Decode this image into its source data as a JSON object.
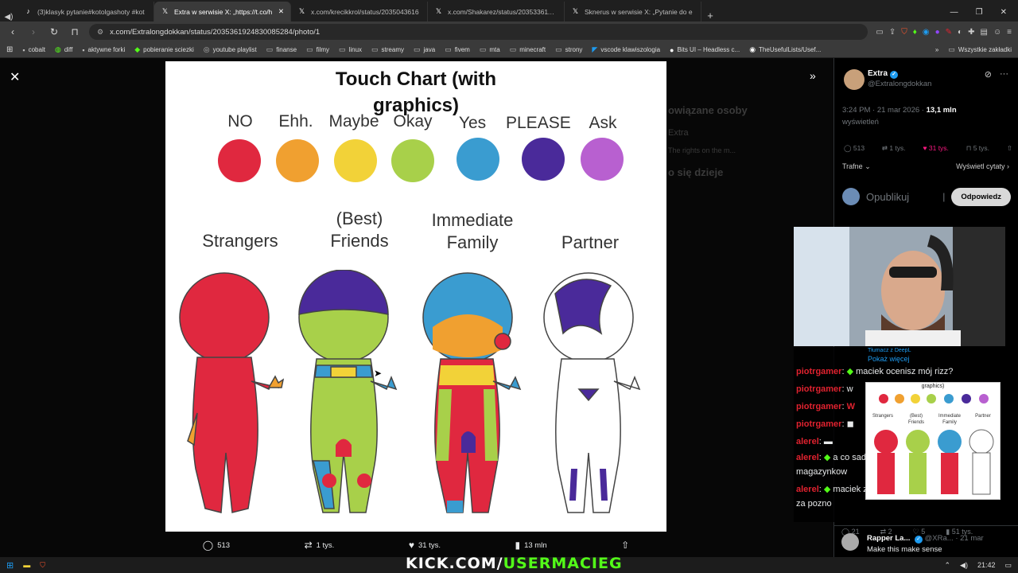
{
  "tabs": [
    {
      "label": "(3)klasyk pytanie#kotolgashoty #kot",
      "active": false
    },
    {
      "label": "Extra w serwisie X: „https://t.co/h",
      "active": true
    },
    {
      "label": "x.com/krecikkrol/status/2035043616",
      "active": false
    },
    {
      "label": "x.com/Shakarez/status/20353361123",
      "active": false
    },
    {
      "label": "Sknerus w serwisie X: „Pytanie do e",
      "active": false
    }
  ],
  "address": {
    "url": "x.com/Extralongdokkan/status/2035361924830085284/photo/1"
  },
  "bookmarks": [
    "cobalt",
    "diff",
    "aktywne forki",
    "pobieranie sciezki",
    "youtube playlist",
    "finanse",
    "filmy",
    "linux",
    "streamy",
    "java",
    "fivem",
    "mta",
    "minecraft",
    "strony",
    "vscode klawiszologia",
    "Bits UI – Headless c...",
    "TheUsefulLists/Usef..."
  ],
  "bookmarks_right": "Wszystkie zakładki",
  "chart": {
    "title_line1": "Touch Chart (with",
    "title_line2": "graphics)",
    "levels": [
      {
        "label": "NO",
        "color": "#e0283f"
      },
      {
        "label": "Ehh.",
        "color": "#f0a030"
      },
      {
        "label": "Maybe",
        "color": "#f2d238"
      },
      {
        "label": "Okay",
        "color": "#a8d04a"
      },
      {
        "label": "Yes",
        "color": "#3a9cd0"
      },
      {
        "label": "PLEASE",
        "color": "#4a2a9a"
      },
      {
        "label": "Ask",
        "color": "#b860d0"
      }
    ],
    "categories": [
      {
        "label_line1": "",
        "label_line2": "Strangers"
      },
      {
        "label_line1": "(Best)",
        "label_line2": "Friends"
      },
      {
        "label_line1": "Immediate",
        "label_line2": "Family"
      },
      {
        "label_line1": "",
        "label_line2": "Partner"
      }
    ]
  },
  "actions": {
    "replies": "513",
    "reposts": "1 tys.",
    "likes": "31 tys.",
    "views": "13 mln"
  },
  "tweet": {
    "name": "Extra",
    "handle": "@Extralongdokkan",
    "time": "3:24 PM · 21 mar 2026 · ",
    "views": "13,1 mln",
    "views_label": "wyświetleń",
    "stats": {
      "replies": "513",
      "reposts": "1 tys.",
      "likes": "31 tys.",
      "bookmarks": "5 tys."
    },
    "sort": "Trafne",
    "quotes": "Wyświetl cytaty",
    "reply_placeholder": "Opublikuj",
    "reply_button": "Odpowiedz"
  },
  "translate": {
    "label": "Tłumacz z DeepL",
    "more": "Pokaż więcej"
  },
  "chat": [
    {
      "user": "piotrgamer",
      "msg": "maciek ocenisz mój rizz?"
    },
    {
      "user": "piotrgamer",
      "msg": "w"
    },
    {
      "user": "piotrgamer",
      "msg": "W"
    },
    {
      "user": "piotrgamer",
      "msg": ""
    },
    {
      "user": "alerel",
      "msg": ""
    },
    {
      "user": "alerel",
      "msg": "a co sadzisz o zmianie systemu magazynkow"
    },
    {
      "user": "alerel",
      "msg": "maciek zajdz dajlepiej kogos zanim bedzie za pozno"
    }
  ],
  "mini_chart": {
    "title": "graphics)",
    "cats": [
      "Strangers",
      "(Best) Friends",
      "Immediate Family",
      "Partner"
    ]
  },
  "bottom_reply": {
    "name": "Rapper La...",
    "handle": "@XRa...",
    "date": "· 21 mar",
    "text": "Make this make sense"
  },
  "bottom_stats": {
    "replies": "21",
    "reposts": "2",
    "likes": "5",
    "views": "51 tys."
  },
  "faded_side": [
    "owiązane osoby",
    "Extra",
    "The rights on the m...",
    "o się dzieje",
    ""
  ],
  "taskbar": {
    "time": "21:42"
  },
  "overlay": {
    "kick_prefix": "KICK.COM/",
    "kick_user": "USERMACIEG"
  }
}
